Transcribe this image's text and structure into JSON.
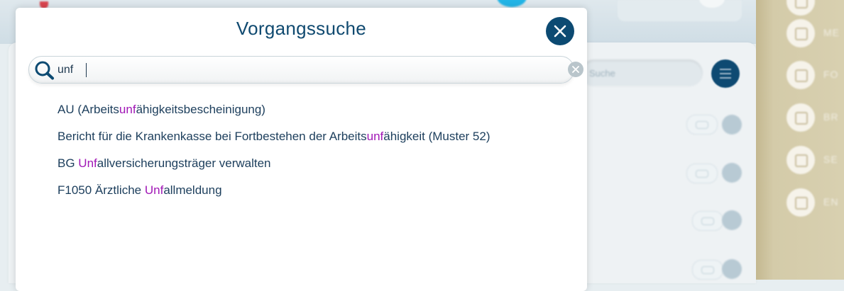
{
  "background": {
    "menu_items": [
      "ME",
      "FO",
      "BR",
      "SE",
      "EN"
    ],
    "search_placeholder": "Suche"
  },
  "modal": {
    "title": "Vorgangssuche",
    "search": {
      "value": "unf"
    },
    "results": [
      {
        "before": "AU (Arbeits",
        "match": "unf",
        "after": "ähigkeitsbescheinigung)"
      },
      {
        "before": "Bericht für die Krankenkasse bei Fortbestehen der Arbeits",
        "match": "unf",
        "after": "ähigkeit (Muster 52)"
      },
      {
        "before": "BG ",
        "match": "Unf",
        "after": "allversicherungsträger verwalten"
      },
      {
        "before": "F1050 Ärztliche ",
        "match": "Unf",
        "after": "allmeldung"
      }
    ]
  },
  "colors": {
    "accent": "#0c4a72",
    "highlight": "#a117b6",
    "text": "#1c3e5c"
  },
  "icons": [
    "search-icon",
    "close-icon",
    "clear-icon",
    "menu-icon"
  ]
}
